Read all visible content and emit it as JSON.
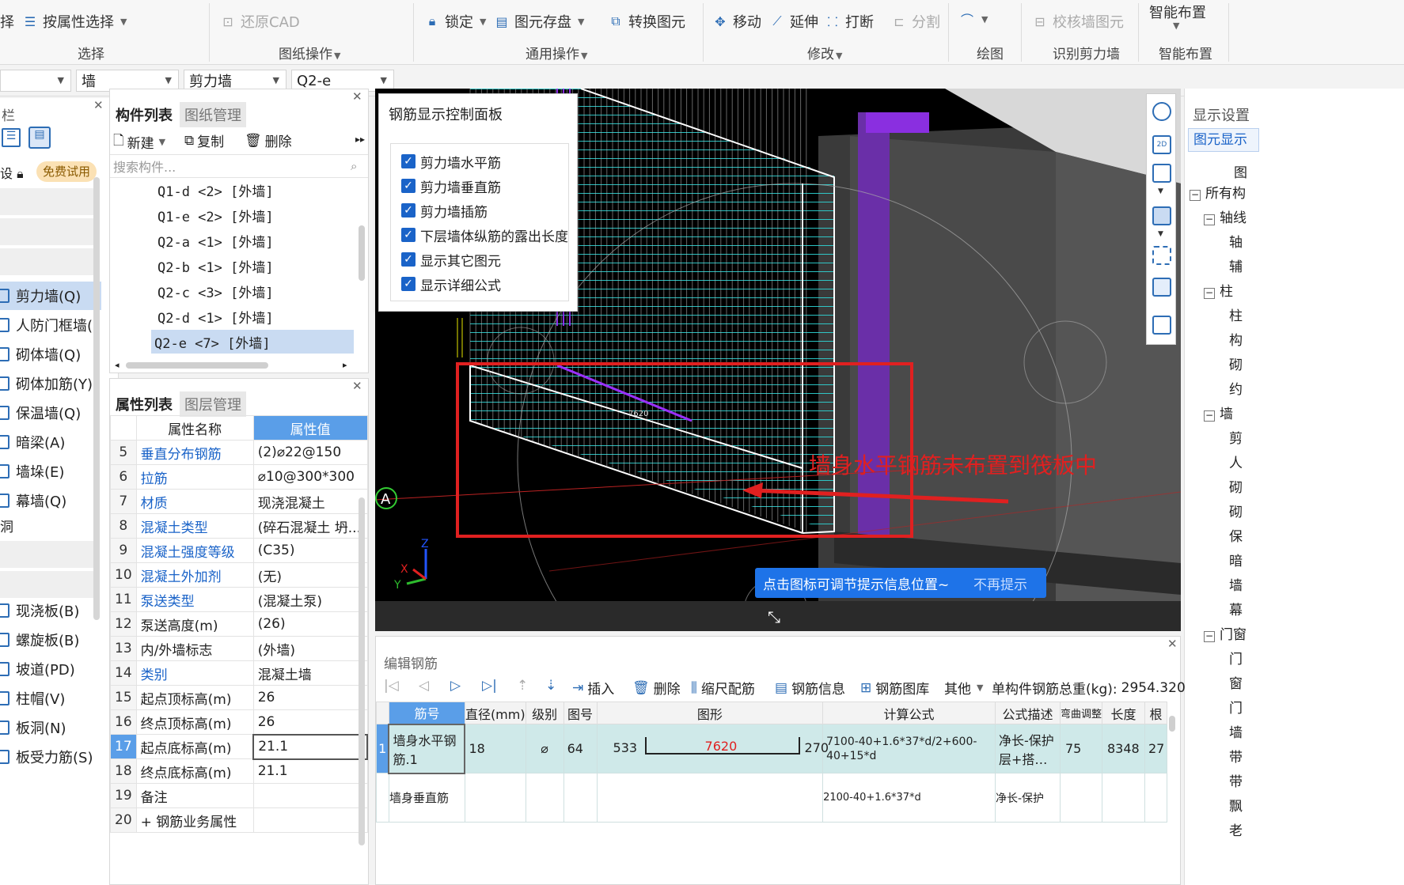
{
  "ribbon": {
    "select_by_prop": "按属性选择",
    "restore_cad": "还原CAD",
    "lock": "锁定",
    "save_elem": "图元存盘",
    "convert_elem": "转换图元",
    "move": "移动",
    "extend": "延伸",
    "break": "打断",
    "split": "分割",
    "check_elem": "校核墙图元",
    "smart_layout": "智能布置",
    "groups": {
      "select": "选择",
      "drawing_ops": "图纸操作",
      "common_ops": "通用操作",
      "modify": "修改",
      "draw": "绘图",
      "recognize_wall": "识别剪力墙",
      "smart_layout": "智能布置"
    }
  },
  "selectors": {
    "s2": "墙",
    "s3": "剪力墙",
    "s4": "Q2-e"
  },
  "leftnav": {
    "title": "栏",
    "trial_badge": "免费试用",
    "items": [
      {
        "label": "剪力墙(Q)",
        "selected": true
      },
      {
        "label": "人防门框墙("
      },
      {
        "label": "砌体墙(Q)"
      },
      {
        "label": "砌体加筋(Y)"
      },
      {
        "label": "保温墙(Q)"
      },
      {
        "label": "暗梁(A)"
      },
      {
        "label": "墙垛(E)"
      },
      {
        "label": "幕墙(Q)"
      }
    ],
    "section_label": "洞",
    "items2": [
      {
        "label": "现浇板(B)"
      },
      {
        "label": "螺旋板(B)"
      },
      {
        "label": "坡道(PD)"
      },
      {
        "label": "柱帽(V)"
      },
      {
        "label": "板洞(N)"
      },
      {
        "label": "板受力筋(S)"
      }
    ]
  },
  "complist": {
    "tab_active": "构件列表",
    "tab_inactive": "图纸管理",
    "new": "新建",
    "copy": "复制",
    "delete": "删除",
    "search_placeholder": "搜索构件...",
    "items": [
      "Q1-d <2> [外墙]",
      "Q1-e <2> [外墙]",
      "Q2-a <1> [外墙]",
      "Q2-b <1> [外墙]",
      "Q2-c <3> [外墙]",
      "Q2-d <1> [外墙]",
      "Q2-e <7> [外墙]"
    ]
  },
  "props": {
    "tab_active": "属性列表",
    "tab_inactive": "图层管理",
    "col_name": "属性名称",
    "col_value": "属性值",
    "rows": [
      {
        "n": "5",
        "name": "垂直分布钢筋",
        "value": "(2)⌀22@150",
        "link": true
      },
      {
        "n": "6",
        "name": "拉筋",
        "value": "⌀10@300*300",
        "link": true
      },
      {
        "n": "7",
        "name": "材质",
        "value": "现浇混凝土",
        "link": true
      },
      {
        "n": "8",
        "name": "混凝土类型",
        "value": "(碎石混凝土 坍...",
        "link": true
      },
      {
        "n": "9",
        "name": "混凝土强度等级",
        "value": "(C35)",
        "link": true
      },
      {
        "n": "10",
        "name": "混凝土外加剂",
        "value": "(无)",
        "link": true
      },
      {
        "n": "11",
        "name": "泵送类型",
        "value": "(混凝土泵)",
        "link": true
      },
      {
        "n": "12",
        "name": "泵送高度(m)",
        "value": "(26)",
        "link": false
      },
      {
        "n": "13",
        "name": "内/外墙标志",
        "value": "(外墙)",
        "link": false
      },
      {
        "n": "14",
        "name": "类别",
        "value": "混凝土墙",
        "link": true
      },
      {
        "n": "15",
        "name": "起点顶标高(m)",
        "value": "26",
        "link": false
      },
      {
        "n": "16",
        "name": "终点顶标高(m)",
        "value": "26",
        "link": false
      },
      {
        "n": "17",
        "name": "起点底标高(m)",
        "value": "21.1",
        "link": false
      },
      {
        "n": "18",
        "name": "终点底标高(m)",
        "value": "21.1",
        "link": false
      },
      {
        "n": "19",
        "name": "备注",
        "value": "",
        "link": false
      },
      {
        "n": "20",
        "name": "+ 钢筋业务属性",
        "value": "",
        "link": false
      }
    ]
  },
  "ctrlpanel": {
    "title": "钢筋显示控制面板",
    "options": [
      "剪力墙水平筋",
      "剪力墙垂直筋",
      "剪力墙插筋",
      "下层墙体纵筋的露出长度",
      "显示其它图元",
      "显示详细公式"
    ]
  },
  "viewport": {
    "annotation": "墙身水平钢筋未布置到筏板中",
    "axis_label": "A",
    "tip_text": "点击图标可调节提示信息位置~",
    "tip_dismiss": "不再提示",
    "dim_label": "7620"
  },
  "rightpanel": {
    "title": "显示设置",
    "tab": "图元显示",
    "header": "图",
    "tree": [
      "所有构",
      "轴线",
      "轴",
      "辅",
      "柱",
      "柱",
      "构",
      "砌",
      "约",
      "墙",
      "剪",
      "人",
      "砌",
      "砌",
      "保",
      "暗",
      "墙",
      "幕",
      "门窗",
      "门",
      "窗",
      "门",
      "墙",
      "带",
      "带",
      "飘",
      "老"
    ]
  },
  "editrebar": {
    "title": "编辑钢筋",
    "insert": "插入",
    "delete": "删除",
    "scale_rebar": "缩尺配筋",
    "rebar_info": "钢筋信息",
    "rebar_lib": "钢筋图库",
    "other": "其他",
    "total_label": "单构件钢筋总重(kg):",
    "total_value": "2954.320",
    "headers": [
      "筋号",
      "直径(mm)",
      "级别",
      "图号",
      "图形",
      "计算公式",
      "公式描述",
      "弯曲调整",
      "长度",
      "根"
    ],
    "row": {
      "idx": "1",
      "name": "墙身水平钢筋.1",
      "diameter": "18",
      "grade": "⌀",
      "fig": "64",
      "left": "533",
      "mid": "7620",
      "right": "270",
      "formula": "7100-40+1.6*37*d/2+600-40+15*d",
      "desc": "净长-保护层+搭…",
      "bend": "75",
      "length": "8348",
      "count": "27"
    },
    "row2": {
      "name": "墙身垂直筋",
      "formula": "2100-40+1.6*37*d",
      "desc": "净长-保护"
    }
  },
  "colors": {
    "accent": "#1a63c8",
    "annotation_red": "#e02020",
    "rebar_cyan": "#2fd6d6",
    "rebar_purple": "#9a30ff",
    "tip_blue": "#1e73e8",
    "selected_row": "#cfe9e9"
  }
}
